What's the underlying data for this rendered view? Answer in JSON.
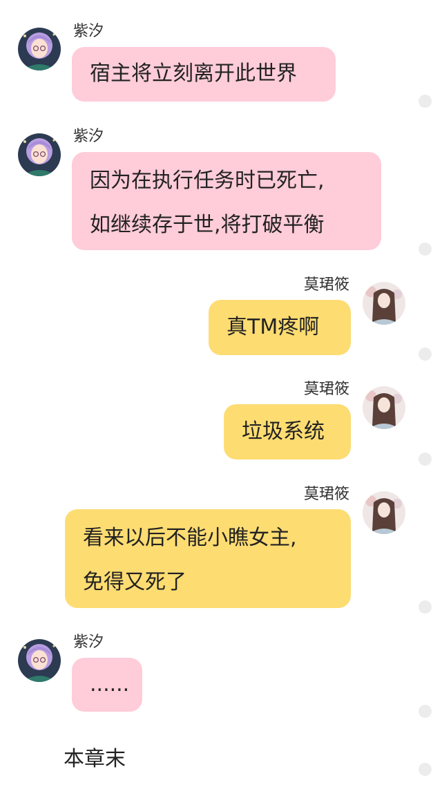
{
  "colors": {
    "left_bubble": "#ffccd9",
    "right_bubble": "#fddc72",
    "read_dot": "#ececec",
    "background": "#ffffff"
  },
  "messages": [
    {
      "side": "left",
      "sender": "紫汐",
      "lines": [
        "宿主将立刻离开此世界"
      ]
    },
    {
      "side": "left",
      "sender": "紫汐",
      "lines": [
        "因为在执行任务时已死亡,",
        "如继续存于世,将打破平衡"
      ]
    },
    {
      "side": "right",
      "sender": "莫珺筱",
      "lines": [
        "真TM疼啊"
      ]
    },
    {
      "side": "right",
      "sender": "莫珺筱",
      "lines": [
        "垃圾系统"
      ]
    },
    {
      "side": "right",
      "sender": "莫珺筱",
      "lines": [
        "看来以后不能小瞧女主,",
        "免得又死了"
      ]
    },
    {
      "side": "left",
      "sender": "紫汐",
      "lines": [
        "......"
      ]
    }
  ],
  "footer": {
    "end_text": "本章末"
  },
  "icons": {
    "left_avatar": "purple-haired-girl-avatar",
    "right_avatar": "long-haired-girl-avatar",
    "read_indicator": "read-dot-icon"
  }
}
